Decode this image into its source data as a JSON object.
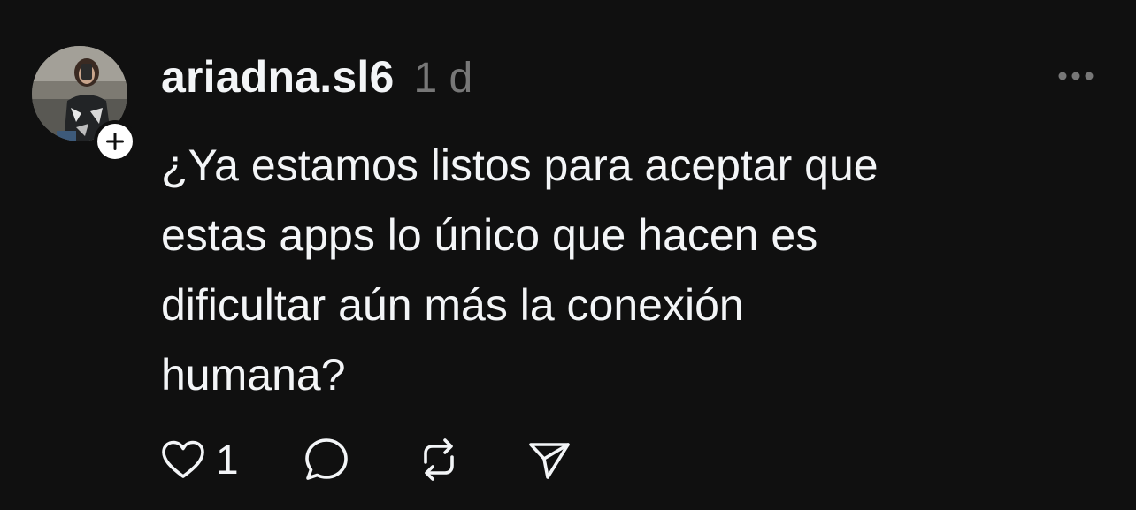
{
  "post": {
    "username": "ariadna.sl6",
    "timestamp": "1 d",
    "text": "¿Ya estamos listos para aceptar que\nestas apps lo único que hacen es\ndificultar aún más la conexión\nhumana?",
    "likes": "1"
  },
  "icons": {
    "avatar": "avatar",
    "follow": "plus-icon",
    "more": "more-dots-icon",
    "like": "heart-icon",
    "reply": "comment-bubble-icon",
    "repost": "repost-icon",
    "share": "send-icon"
  },
  "colors": {
    "background": "#101010",
    "text": "#f3f5f7",
    "muted": "#777777"
  }
}
